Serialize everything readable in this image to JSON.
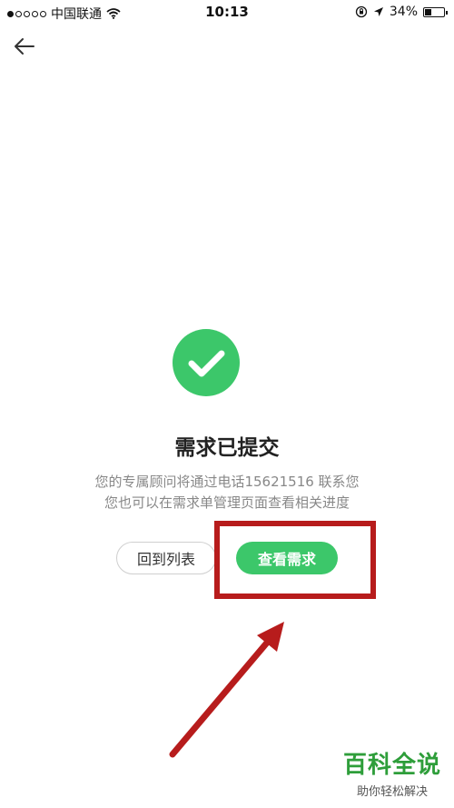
{
  "status_bar": {
    "carrier": "中国联通",
    "time": "10:13",
    "battery": "34%",
    "battery_level": 0.34
  },
  "icons": {
    "back": "arrow-left-icon",
    "success": "check-circle-icon",
    "wifi": "wifi-icon",
    "location": "location-arrow-icon",
    "lock": "rotation-lock-icon"
  },
  "main": {
    "title": "需求已提交",
    "message_line1": "您的专属顾问将通过电话15621516   联系您",
    "message_line2": "您也可以在需求单管理页面查看相关进度"
  },
  "buttons": {
    "back_to_list": "回到列表",
    "view_request": "查看需求"
  },
  "watermark": {
    "title": "百科全说",
    "subtitle": "助你轻松解决"
  },
  "colors": {
    "accent": "#3cc76a",
    "highlight": "#b71c1c"
  }
}
